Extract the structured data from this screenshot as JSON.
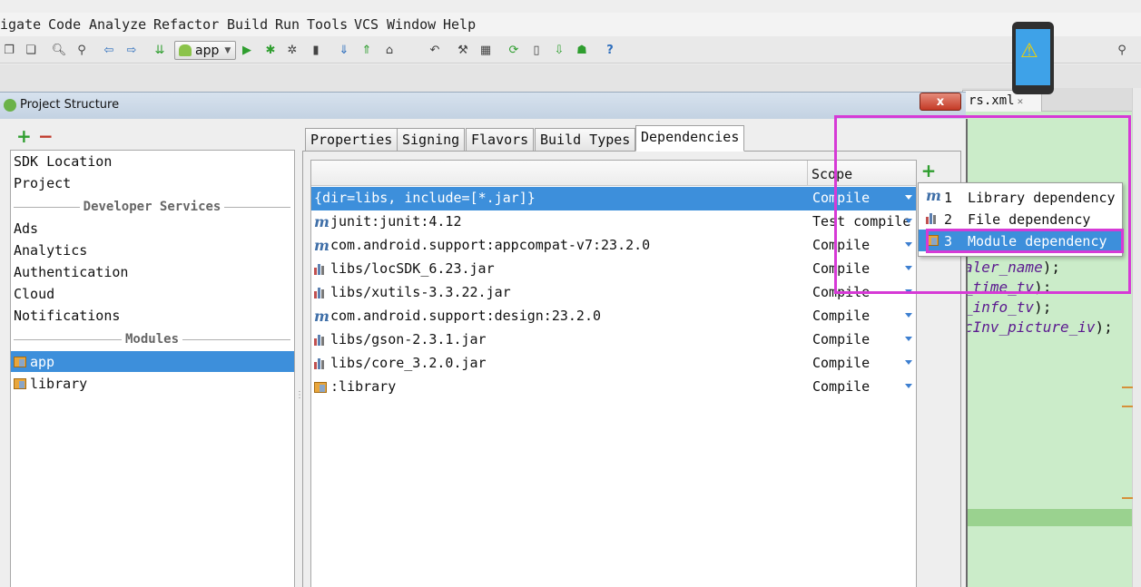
{
  "menubar": {
    "items": [
      "igate",
      "Code",
      "Analyze",
      "Refactor",
      "Build",
      "Run",
      "Tools",
      "VCS",
      "Window",
      "Help"
    ]
  },
  "toolbar": {
    "run_config": "app",
    "icons": [
      "copy-icon",
      "paste-icon",
      "find-icon",
      "replace-icon",
      "back-icon",
      "forward-icon",
      "make-icon",
      "run-icon",
      "debug-icon",
      "attach-icon",
      "stop-icon",
      "vcs-update-icon",
      "vcs-commit-icon",
      "history-icon",
      "revert-icon",
      "settings-icon",
      "project-structure-icon",
      "sync-icon",
      "avd-icon",
      "sdk-icon",
      "android-icon",
      "help-icon"
    ],
    "help_label": "?",
    "search_icon": "search-icon"
  },
  "editor": {
    "tab_label": "rs.xml",
    "lines": [
      {
        "text": "aler_name",
        "suffix": ");"
      },
      {
        "text": "_time_tv",
        "suffix": ");"
      },
      {
        "text": "_info_tv",
        "suffix": ");"
      },
      {
        "text": "cInv_picture_iv",
        "suffix": ");"
      }
    ]
  },
  "dialog": {
    "title": "Project Structure",
    "close_label": "x",
    "left_add": "+",
    "left_remove": "−",
    "left_items_top": [
      "SDK Location",
      "Project"
    ],
    "section_developer": "Developer Services",
    "developer_items": [
      "Ads",
      "Analytics",
      "Authentication",
      "Cloud",
      "Notifications"
    ],
    "section_modules": "Modules",
    "modules": [
      "app",
      "library"
    ],
    "selected_module": "app",
    "tabs": [
      "Properties",
      "Signing",
      "Flavors",
      "Build Types",
      "Dependencies"
    ],
    "active_tab": "Dependencies",
    "scope_header": "Scope",
    "add_dependency": "+",
    "dependencies": [
      {
        "icon": "none",
        "name": "{dir=libs, include=[*.jar]}",
        "scope": "Compile"
      },
      {
        "icon": "maven-m-icon",
        "name": "junit:junit:4.12",
        "scope": "Test compile"
      },
      {
        "icon": "maven-m-icon",
        "name": "com.android.support:appcompat-v7:23.2.0",
        "scope": "Compile"
      },
      {
        "icon": "jar-icon",
        "name": "libs/locSDK_6.23.jar",
        "scope": "Compile"
      },
      {
        "icon": "jar-icon",
        "name": "libs/xutils-3.3.22.jar",
        "scope": "Compile"
      },
      {
        "icon": "maven-m-icon",
        "name": "com.android.support:design:23.2.0",
        "scope": "Compile"
      },
      {
        "icon": "jar-icon",
        "name": "libs/gson-2.3.1.jar",
        "scope": "Compile"
      },
      {
        "icon": "jar-icon",
        "name": "libs/core_3.2.0.jar",
        "scope": "Compile"
      },
      {
        "icon": "module-icon",
        "name": ":library",
        "scope": "Compile"
      }
    ]
  },
  "popup": {
    "items": [
      {
        "num": "1",
        "label": "Library dependency",
        "icon": "maven-m-icon"
      },
      {
        "num": "2",
        "label": "File dependency",
        "icon": "jar-icon"
      },
      {
        "num": "3",
        "label": "Module dependency",
        "icon": "module-icon"
      }
    ],
    "selected": "3"
  },
  "colors": {
    "selection": "#3d8fdb",
    "annotation": "#d63ad6",
    "editor_bg": "#cbecc9",
    "add_green": "#2f9e2f",
    "remove_red": "#c0392b"
  }
}
